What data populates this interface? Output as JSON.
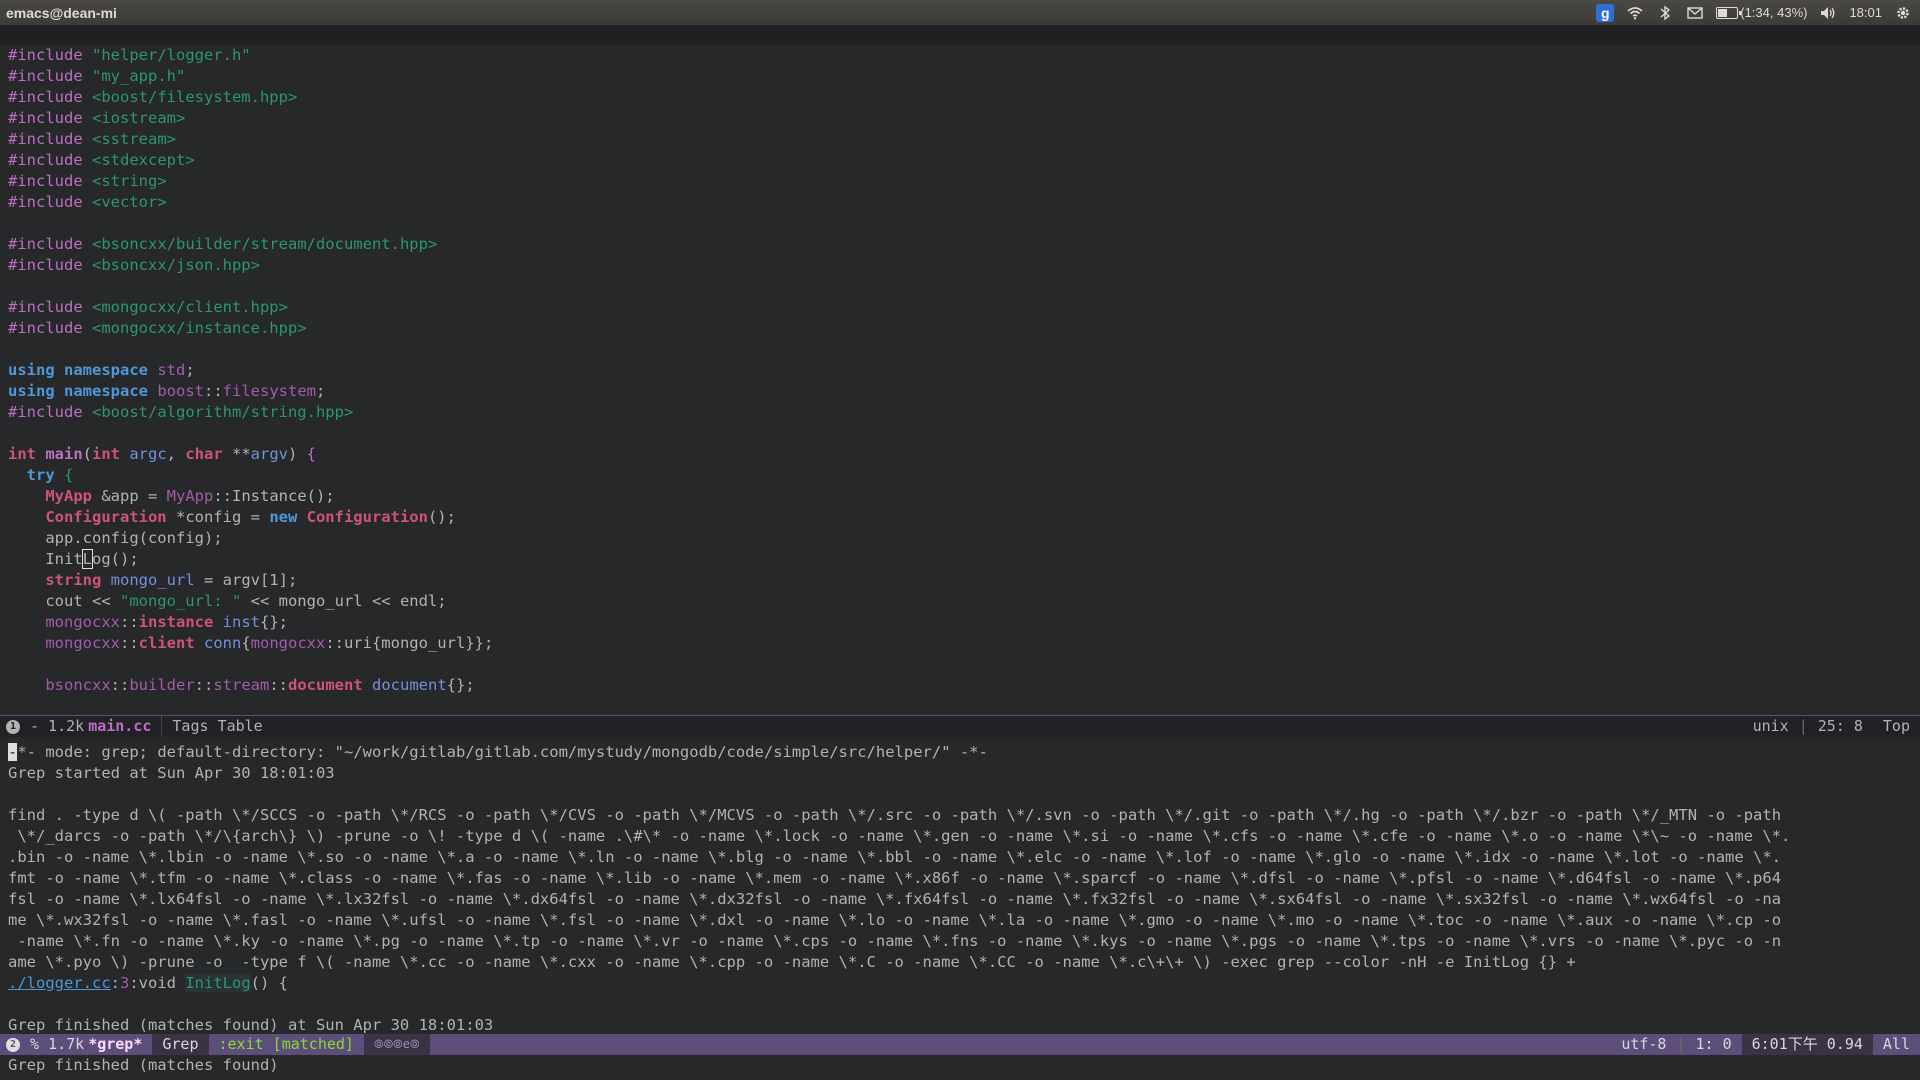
{
  "topbar": {
    "title": "emacs@dean-mi",
    "battery_text": "(1:34, 43%)",
    "battery_level": 0.43,
    "clock": "18:01",
    "icons": [
      "google-icon",
      "wifi-icon",
      "bluetooth-icon",
      "mail-icon",
      "battery-icon",
      "volume-icon",
      "gear-icon"
    ]
  },
  "code": [
    [
      [
        "#include ",
        "pp"
      ],
      [
        "\"helper/logger.h\"",
        "str"
      ]
    ],
    [
      [
        "#include ",
        "pp"
      ],
      [
        "\"my_app.h\"",
        "str"
      ]
    ],
    [
      [
        "#include ",
        "pp"
      ],
      [
        "<boost/filesystem.hpp>",
        "str"
      ]
    ],
    [
      [
        "#include ",
        "pp"
      ],
      [
        "<iostream>",
        "str"
      ]
    ],
    [
      [
        "#include ",
        "pp"
      ],
      [
        "<sstream>",
        "str"
      ]
    ],
    [
      [
        "#include ",
        "pp"
      ],
      [
        "<stdexcept>",
        "str"
      ]
    ],
    [
      [
        "#include ",
        "pp"
      ],
      [
        "<string>",
        "str"
      ]
    ],
    [
      [
        "#include ",
        "pp"
      ],
      [
        "<vector>",
        "str"
      ]
    ],
    [],
    [
      [
        "#include ",
        "pp"
      ],
      [
        "<bsoncxx/builder/stream/document.hpp>",
        "str"
      ]
    ],
    [
      [
        "#include ",
        "pp"
      ],
      [
        "<bsoncxx/json.hpp>",
        "str"
      ]
    ],
    [],
    [
      [
        "#include ",
        "pp"
      ],
      [
        "<mongocxx/client.hpp>",
        "str"
      ]
    ],
    [
      [
        "#include ",
        "pp"
      ],
      [
        "<mongocxx/instance.hpp>",
        "str"
      ]
    ],
    [],
    [
      [
        "using ",
        "kw"
      ],
      [
        "namespace ",
        "kw"
      ],
      [
        "std",
        "ns"
      ],
      [
        ";",
        "plain"
      ]
    ],
    [
      [
        "using ",
        "kw"
      ],
      [
        "namespace ",
        "kw"
      ],
      [
        "boost",
        "ns"
      ],
      [
        "::",
        "plain"
      ],
      [
        "filesystem",
        "ns"
      ],
      [
        ";",
        "plain"
      ]
    ],
    [
      [
        "#include ",
        "pp"
      ],
      [
        "<boost/algorithm/string.hpp>",
        "str"
      ]
    ],
    [],
    [
      [
        "int ",
        "type"
      ],
      [
        "main",
        "fn"
      ],
      [
        "(",
        "plain"
      ],
      [
        "int ",
        "type"
      ],
      [
        "argc",
        "var"
      ],
      [
        ", ",
        "plain"
      ],
      [
        "char ",
        "type"
      ],
      [
        "**",
        "plain"
      ],
      [
        "argv",
        "var"
      ],
      [
        ") ",
        "plain"
      ],
      [
        "{",
        "brace"
      ]
    ],
    [
      [
        "  try ",
        "kw"
      ],
      [
        "{",
        "str"
      ]
    ],
    [
      [
        "    MyApp ",
        "type"
      ],
      [
        "&app = ",
        "plain"
      ],
      [
        "MyApp",
        "ns"
      ],
      [
        "::Instance();",
        "plain"
      ]
    ],
    [
      [
        "    Configuration ",
        "type"
      ],
      [
        "*config = ",
        "plain"
      ],
      [
        "new ",
        "kw"
      ],
      [
        "Configuration",
        "type"
      ],
      [
        "();",
        "plain"
      ]
    ],
    [
      [
        "    app.config(config);",
        "plain"
      ]
    ],
    [
      [
        "    Init",
        "plain"
      ],
      [
        "L",
        "cursor"
      ],
      [
        "og();",
        "plain"
      ]
    ],
    [
      [
        "    string ",
        "type"
      ],
      [
        "mongo_url",
        "var"
      ],
      [
        " = argv[1];",
        "plain"
      ]
    ],
    [
      [
        "    cout << ",
        "plain"
      ],
      [
        "\"mongo_url: \"",
        "str"
      ],
      [
        " << mongo_url << endl;",
        "plain"
      ]
    ],
    [
      [
        "    mongocxx",
        "ns"
      ],
      [
        "::",
        "plain"
      ],
      [
        "instance ",
        "type"
      ],
      [
        "inst",
        "var"
      ],
      [
        "{};",
        "plain"
      ]
    ],
    [
      [
        "    mongocxx",
        "ns"
      ],
      [
        "::",
        "plain"
      ],
      [
        "client ",
        "type"
      ],
      [
        "conn",
        "var"
      ],
      [
        "{",
        "plain"
      ],
      [
        "mongocxx",
        "ns"
      ],
      [
        "::uri{mongo_url}};",
        "plain"
      ]
    ],
    [],
    [
      [
        "    bsoncxx",
        "ns"
      ],
      [
        "::",
        "plain"
      ],
      [
        "builder",
        "ns"
      ],
      [
        "::",
        "plain"
      ],
      [
        "stream",
        "ns"
      ],
      [
        "::",
        "plain"
      ],
      [
        "document ",
        "type"
      ],
      [
        "document",
        "var"
      ],
      [
        "{};",
        "plain"
      ]
    ]
  ],
  "modeline_top": {
    "window_number": "1",
    "buffer_size": "- 1.2k",
    "buffer_name": "main.cc",
    "tags": "Tags Table",
    "encoding": "unix",
    "position": "25: 8",
    "scroll": "Top"
  },
  "grep": [
    [
      [
        "-",
        "blockcur"
      ],
      [
        "*- mode: grep; default-directory: \"~/work/gitlab/gitlab.com/mystudy/mongodb/code/simple/src/helper/\" -*-",
        "plain"
      ]
    ],
    [
      [
        "Grep started at Sun Apr 30 18:01:03",
        "plain"
      ]
    ],
    [],
    [
      [
        "find . -type d \\( -path \\*/SCCS -o -path \\*/RCS -o -path \\*/CVS -o -path \\*/MCVS -o -path \\*/.src -o -path \\*/.svn -o -path \\*/.git -o -path \\*/.hg -o -path \\*/.bzr -o -path \\*/_MTN -o -path",
        "plain"
      ]
    ],
    [
      [
        " \\*/_darcs -o -path \\*/\\{arch\\} \\) -prune -o \\! -type d \\( -name .\\#\\* -o -name \\*.lock -o -name \\*.gen -o -name \\*.si -o -name \\*.cfs -o -name \\*.cfe -o -name \\*.o -o -name \\*\\~ -o -name \\*.",
        "plain"
      ]
    ],
    [
      [
        ".bin -o -name \\*.lbin -o -name \\*.so -o -name \\*.a -o -name \\*.ln -o -name \\*.blg -o -name \\*.bbl -o -name \\*.elc -o -name \\*.lof -o -name \\*.glo -o -name \\*.idx -o -name \\*.lot -o -name \\*.",
        "plain"
      ]
    ],
    [
      [
        "fmt -o -name \\*.tfm -o -name \\*.class -o -name \\*.fas -o -name \\*.lib -o -name \\*.mem -o -name \\*.x86f -o -name \\*.sparcf -o -name \\*.dfsl -o -name \\*.pfsl -o -name \\*.d64fsl -o -name \\*.p64",
        "plain"
      ]
    ],
    [
      [
        "fsl -o -name \\*.lx64fsl -o -name \\*.lx32fsl -o -name \\*.dx64fsl -o -name \\*.dx32fsl -o -name \\*.fx64fsl -o -name \\*.fx32fsl -o -name \\*.sx64fsl -o -name \\*.sx32fsl -o -name \\*.wx64fsl -o -na",
        "plain"
      ]
    ],
    [
      [
        "me \\*.wx32fsl -o -name \\*.fasl -o -name \\*.ufsl -o -name \\*.fsl -o -name \\*.dxl -o -name \\*.lo -o -name \\*.la -o -name \\*.gmo -o -name \\*.mo -o -name \\*.toc -o -name \\*.aux -o -name \\*.cp -o",
        "plain"
      ]
    ],
    [
      [
        " -name \\*.fn -o -name \\*.ky -o -name \\*.pg -o -name \\*.tp -o -name \\*.vr -o -name \\*.cps -o -name \\*.fns -o -name \\*.kys -o -name \\*.pgs -o -name \\*.tps -o -name \\*.vrs -o -name \\*.pyc -o -n",
        "plain"
      ]
    ],
    [
      [
        "ame \\*.pyo \\) -prune -o  -type f \\( -name \\*.cc -o -name \\*.cxx -o -name \\*.cpp -o -name \\*.C -o -name \\*.CC -o -name \\*.c\\+\\+ \\) -exec grep --color -nH -e InitLog {} +",
        "plain"
      ]
    ],
    [
      [
        "./logger.cc",
        "link"
      ],
      [
        ":",
        "plain"
      ],
      [
        "3",
        "num"
      ],
      [
        ":void ",
        "plain"
      ],
      [
        "InitLog",
        "match"
      ],
      [
        "() {",
        "plain"
      ]
    ],
    [],
    [
      [
        "Grep finished (matches found) at Sun Apr 30 18:01:03",
        "plain"
      ]
    ]
  ],
  "modeline_bottom": {
    "window_number": "2",
    "buffer_size": "% 1.7k",
    "buffer_name": "*grep*",
    "mode": "Grep",
    "exit_status": ":exit [matched]",
    "dots": "⦾⦾⦾e⦾",
    "encoding": "utf-8",
    "position": "1: 0",
    "time_load": "6:01下午 0.94",
    "scroll": "All"
  },
  "echo_area": "Grep finished (matches found)"
}
